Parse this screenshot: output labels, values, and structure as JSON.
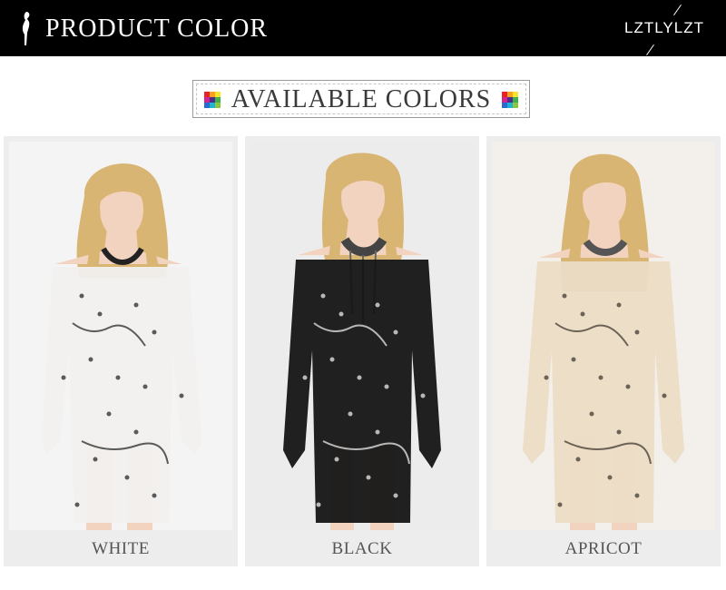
{
  "header": {
    "title": "PRODUCT COLOR",
    "brand": "LZTLYLZT",
    "background": "#000000",
    "text_color": "#ffffff",
    "logo_icon": "woman-silhouette-icon"
  },
  "section": {
    "title": "AVAILABLE COLORS",
    "icon": "color-grid-icon"
  },
  "colors": [
    {
      "label": "WHITE",
      "dress_color": "#f1f0ee",
      "sequin_color": "#5a5a5a",
      "photo_bg": "#f4f4f4"
    },
    {
      "label": "BLACK",
      "dress_color": "#151515",
      "sequin_color": "#b8b8b8",
      "photo_bg": "#ececec"
    },
    {
      "label": "APRICOT",
      "dress_color": "#ecdcc6",
      "sequin_color": "#6b6355",
      "photo_bg": "#f3f0ec"
    }
  ]
}
